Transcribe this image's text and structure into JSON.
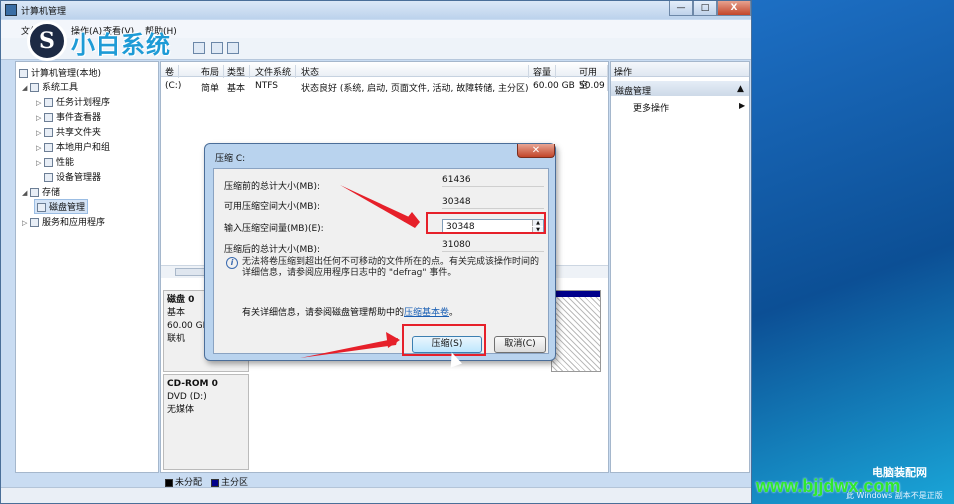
{
  "window": {
    "title": "计算机管理",
    "min": "—",
    "max": "□",
    "close": "X"
  },
  "menu": [
    "文件(F)",
    "操作(A)",
    "查看(V)",
    "帮助(H)"
  ],
  "logo": {
    "mark": "S",
    "text": "小白系统"
  },
  "tree": {
    "root": "计算机管理(本地)",
    "system_tools": "系统工具",
    "task_scheduler": "任务计划程序",
    "event_viewer": "事件查看器",
    "shared_folders": "共享文件夹",
    "local_users": "本地用户和组",
    "performance": "性能",
    "device_manager": "设备管理器",
    "storage": "存储",
    "disk_management": "磁盘管理",
    "services": "服务和应用程序"
  },
  "volume_table": {
    "headers": [
      "卷",
      "布局",
      "类型",
      "文件系统",
      "状态",
      "容量",
      "可用空"
    ],
    "row": [
      "(C:)",
      "简单",
      "基本",
      "NTFS",
      "状态良好 (系统, 启动, 页面文件, 活动, 故障转储, 主分区)",
      "60.00 GB",
      "50.09"
    ]
  },
  "disks": [
    {
      "name": "磁盘 0",
      "type": "基本",
      "size": "60.00 GB",
      "status": "联机"
    },
    {
      "name": "CD-ROM 0",
      "type": "DVD (D:)",
      "size": "",
      "status": "无媒体"
    }
  ],
  "legend": {
    "unallocated": "未分配",
    "primary": "主分区"
  },
  "actions": {
    "header": "操作",
    "section": "磁盘管理",
    "more": "更多操作"
  },
  "dialog": {
    "title": "压缩 C:",
    "total_before_label": "压缩前的总计大小(MB):",
    "total_before": "61436",
    "available_label": "可用压缩空间大小(MB):",
    "available": "30348",
    "input_label": "输入压缩空间量(MB)(E):",
    "input": "30348",
    "total_after_label": "压缩后的总计大小(MB):",
    "total_after": "31080",
    "note": "无法将卷压缩到超出任何不可移动的文件所在的点。有关完成该操作时间的详细信息，请参阅应用程序日志中的 \"defrag\" 事件。",
    "help_prefix": "有关详细信息，请参阅磁盘管理帮助中的",
    "help_link": "压缩基本卷",
    "help_suffix": "。",
    "ok": "压缩(S)",
    "cancel": "取消(C)"
  },
  "desktop": {
    "text1": "电脑装配网",
    "text2": "此 Windows 副本不是正版",
    "watermark": "www.bjjdwx.com"
  },
  "colors": {
    "accent": "#1e9bd6",
    "highlight": "#e6202a"
  }
}
